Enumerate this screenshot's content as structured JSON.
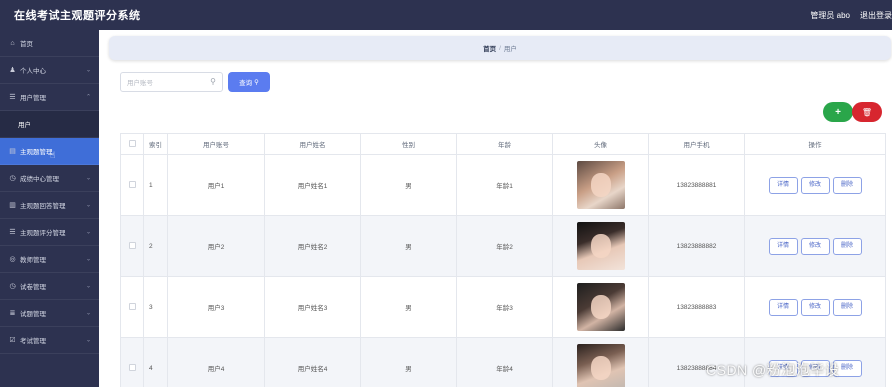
{
  "app": {
    "title": "在线考试主观题评分系统"
  },
  "header": {
    "user_label": "管理员 abo",
    "logout_label": "退出登录"
  },
  "sidebar": {
    "items": [
      {
        "label": "首页",
        "icon": "home-icon",
        "glyph": "⌂"
      },
      {
        "label": "个人中心",
        "icon": "user-icon",
        "glyph": "♟",
        "chevron": "⌄"
      },
      {
        "label": "用户管理",
        "icon": "list-icon",
        "glyph": "☰",
        "chevron": "⌃"
      },
      {
        "label": "用户",
        "sub": true
      },
      {
        "label": "主观题管理",
        "icon": "document-icon",
        "glyph": "▤",
        "active": true
      },
      {
        "label": "成绩中心管理",
        "icon": "clock-icon",
        "glyph": "◷",
        "chevron": "⌄"
      },
      {
        "label": "主观题回答管理",
        "icon": "bar-chart-icon",
        "glyph": "▥",
        "chevron": "⌄"
      },
      {
        "label": "主观题评分管理",
        "icon": "menu-icon",
        "glyph": "☰",
        "chevron": "⌄"
      },
      {
        "label": "教师管理",
        "icon": "settings-icon",
        "glyph": "◎",
        "chevron": "⌄"
      },
      {
        "label": "试卷管理",
        "icon": "clock-icon",
        "glyph": "◷",
        "chevron": "⌄"
      },
      {
        "label": "试题管理",
        "icon": "database-icon",
        "glyph": "≣",
        "chevron": "⌄"
      },
      {
        "label": "考试管理",
        "icon": "form-icon",
        "glyph": "☑",
        "chevron": "⌄"
      }
    ]
  },
  "breadcrumb": {
    "home": "首页",
    "separator": "/",
    "current": "用户"
  },
  "search": {
    "placeholder": "用户账号",
    "button_label": "查询",
    "button_icon": "search-icon"
  },
  "actions": {
    "add_glyph": "+",
    "delete_glyph": "🗑"
  },
  "table": {
    "headers": [
      "索引",
      "用户账号",
      "用户姓名",
      "性别",
      "年龄",
      "头像",
      "用户手机",
      "操作"
    ],
    "rows": [
      {
        "index": "1",
        "account": "用户1",
        "name": "用户姓名1",
        "gender": "男",
        "age": "年龄1",
        "phone": "13823888881"
      },
      {
        "index": "2",
        "account": "用户2",
        "name": "用户姓名2",
        "gender": "男",
        "age": "年龄2",
        "phone": "13823888882"
      },
      {
        "index": "3",
        "account": "用户3",
        "name": "用户姓名3",
        "gender": "男",
        "age": "年龄3",
        "phone": "13823888883"
      },
      {
        "index": "4",
        "account": "用户4",
        "name": "用户姓名4",
        "gender": "男",
        "age": "年龄4",
        "phone": "13823888884"
      }
    ],
    "row_actions": {
      "detail": "详情",
      "edit": "修改",
      "delete": "删除"
    }
  },
  "watermark": "CSDN @粉泡泡毕设",
  "colors": {
    "header_bg": "#2d3250",
    "sidebar_bg": "#2d3250",
    "active_item": "#3f6ed8",
    "search_button": "#5b7cf0",
    "add_button": "#2aa64a",
    "delete_button": "#d7262f"
  }
}
